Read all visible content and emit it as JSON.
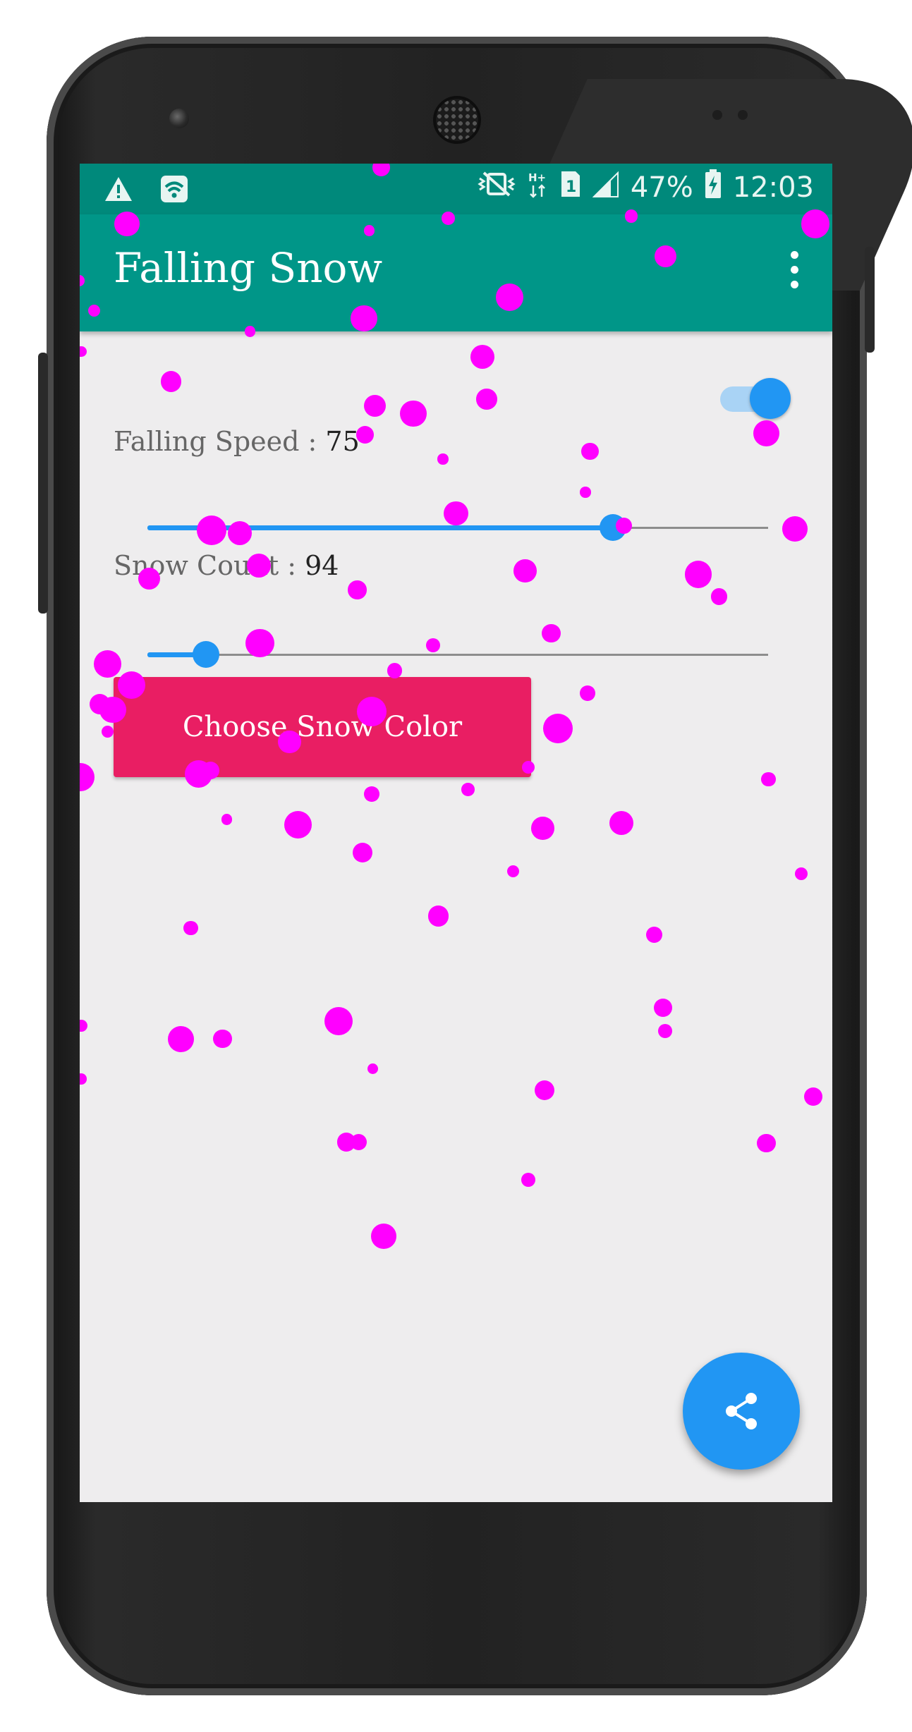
{
  "status_bar": {
    "battery": "47%",
    "time": "12:03",
    "icons": [
      "warning-icon",
      "wifi-icon",
      "vibrate-icon",
      "hplus-network-icon",
      "sim-1-icon",
      "signal-icon",
      "battery-charging-icon"
    ]
  },
  "app_bar": {
    "title": "Falling Snow",
    "menu_icon": "overflow-menu-icon"
  },
  "controls": {
    "snow_toggle": {
      "enabled": true
    },
    "falling_speed": {
      "label": "Falling Speed : ",
      "value": "75",
      "fraction": 0.75
    },
    "snow_count": {
      "label": "Snow Count : ",
      "value": "94",
      "fraction": 0.094
    },
    "choose_color_label": "Choose Snow Color"
  },
  "fab": {
    "icon": "share-icon"
  },
  "colors": {
    "status_bar": "#00897b",
    "app_bar": "#009688",
    "accent": "#2196f3",
    "button": "#e91e63",
    "snow": "#ff00ff",
    "background": "#eeedee"
  }
}
